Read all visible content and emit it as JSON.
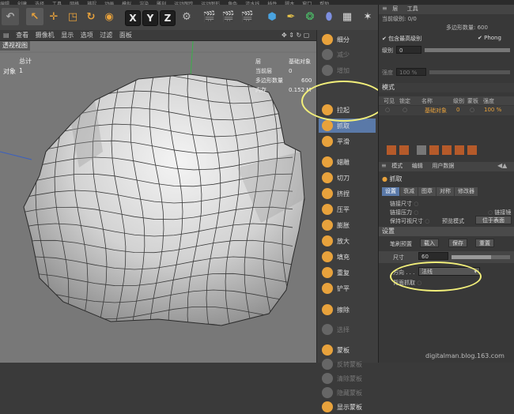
{
  "menubar": [
    "编辑",
    "创建",
    "选择",
    "工具",
    "网格",
    "捕捉",
    "动画",
    "模拟",
    "渲染",
    "雕刻",
    "运动跟踪",
    "运动图形",
    "角色",
    "流水线",
    "插件",
    "脚本",
    "窗口",
    "帮助"
  ],
  "toolbar": {
    "x_label": "X",
    "y_label": "Y",
    "z_label": "Z"
  },
  "viewport": {
    "menu": [
      "查看",
      "摄像机",
      "显示",
      "选项",
      "过滤",
      "面板"
    ],
    "title": "透视视图",
    "stats_left": {
      "label1": "总计",
      "label2": "对象",
      "value2": "1"
    },
    "stats_right": {
      "l1": "层",
      "v1": "基础对象",
      "l2": "当前层",
      "v2": "0",
      "l3": "多边形数量",
      "v3": "600",
      "l4": "内存",
      "v4": "0.152 M"
    }
  },
  "palette": {
    "items": [
      {
        "label": "细分",
        "dim": false,
        "color": "#e8a23c"
      },
      {
        "label": "减少",
        "dim": true,
        "color": "#666"
      },
      {
        "label": "增加",
        "dim": true,
        "color": "#666"
      },
      {
        "label": "拉起",
        "dim": false,
        "color": "#e8a23c"
      },
      {
        "label": "抓取",
        "dim": false,
        "color": "#e8a23c",
        "selected": true
      },
      {
        "label": "平滑",
        "dim": false,
        "color": "#e8a23c"
      },
      {
        "label": "蜡雕",
        "dim": false,
        "color": "#e8a23c"
      },
      {
        "label": "切刀",
        "dim": false,
        "color": "#e8a23c"
      },
      {
        "label": "挤捏",
        "dim": false,
        "color": "#e8a23c"
      },
      {
        "label": "压平",
        "dim": false,
        "color": "#e8a23c"
      },
      {
        "label": "膨胀",
        "dim": false,
        "color": "#e8a23c"
      },
      {
        "label": "放大",
        "dim": false,
        "color": "#e8a23c"
      },
      {
        "label": "填充",
        "dim": false,
        "color": "#e8a23c"
      },
      {
        "label": "重复",
        "dim": false,
        "color": "#e8a23c"
      },
      {
        "label": "铲平",
        "dim": false,
        "color": "#e8a23c"
      },
      {
        "label": "擦除",
        "dim": false,
        "color": "#e8a23c"
      },
      {
        "label": "选择",
        "dim": true,
        "color": "#666"
      },
      {
        "label": "蒙板",
        "dim": false,
        "color": "#e8a23c"
      },
      {
        "label": "反转蒙板",
        "dim": true,
        "color": "#666"
      },
      {
        "label": "清除蒙板",
        "dim": true,
        "color": "#666"
      },
      {
        "label": "隐藏蒙板",
        "dim": true,
        "color": "#666"
      },
      {
        "label": "显示蒙板",
        "dim": false,
        "color": "#e8a23c"
      }
    ]
  },
  "rpanel": {
    "header_tabs": [
      "层",
      "工具"
    ],
    "current_level_label": "当前级别: 0/0",
    "poly_count_label": "多边形数量: 600",
    "include_levels": "包含最高级别",
    "phong": "Phong",
    "level_label": "级别",
    "level_value": "0",
    "strength_label": "强度",
    "strength_value": "100 %",
    "mode_label": "模式",
    "layer_cols": [
      "可见",
      "锁定",
      "名称",
      "级别",
      "蒙板",
      "强度"
    ],
    "layer_row": {
      "name": "基础对象",
      "level": "0",
      "strength": "100 %"
    },
    "attr_tabs": [
      "模式",
      "编辑",
      "用户数据"
    ],
    "tool_name": "抓取",
    "sub_tabs": [
      "设置",
      "衰减",
      "图章",
      "对称",
      "修改器"
    ],
    "link_size": "链接尺寸",
    "link_pressure": "链接压力",
    "link_mirror": "链接镜像",
    "keep_visible_size": "保持可视尺寸",
    "preview_mode": "预览模式",
    "preview_value": "位于表面",
    "settings_header": "设置",
    "brush_preset": "笔刷预置",
    "load_btn": "载入",
    "save_btn": "保存",
    "reset_btn": "重置",
    "size_label": "尺寸",
    "size_value": "60",
    "direction_label": "方向 . . .",
    "direction_value": "法线",
    "backface_label": "背面抓取"
  },
  "watermark": "digitalman.blog.163.com",
  "colors": {
    "highlight": "#f2ef7a",
    "accent": "#5a79a8",
    "orange": "#e8a23c"
  }
}
